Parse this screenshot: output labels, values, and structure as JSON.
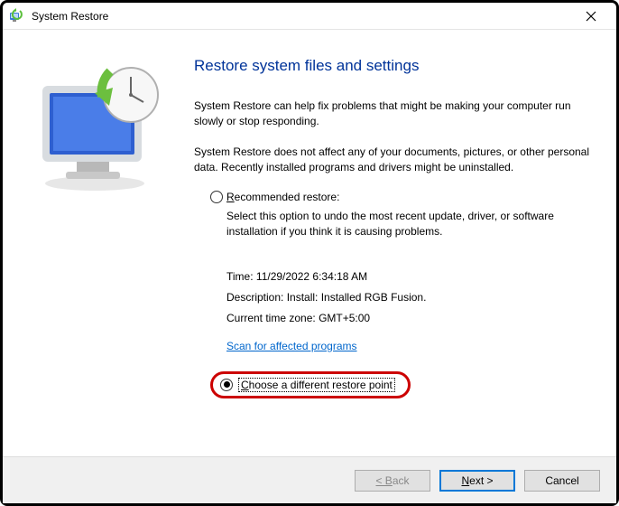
{
  "window": {
    "title": "System Restore"
  },
  "main": {
    "heading": "Restore system files and settings",
    "intro1": "System Restore can help fix problems that might be making your computer run slowly or stop responding.",
    "intro2": "System Restore does not affect any of your documents, pictures, or other personal data. Recently installed programs and drivers might be uninstalled."
  },
  "options": {
    "recommended": {
      "label": "Recommended restore:",
      "desc": "Select this option to undo the most recent update, driver, or software installation if you think it is causing problems.",
      "time_label": "Time:",
      "time_value": "11/29/2022 6:34:18 AM",
      "desc_label": "Description:",
      "desc_value": "Install: Installed RGB Fusion.",
      "tz_label": "Current time zone:",
      "tz_value": "GMT+5:00",
      "scan_link": "Scan for affected programs"
    },
    "different": {
      "label": "Choose a different restore point"
    },
    "selected": "different"
  },
  "footer": {
    "back": "< Back",
    "next": "Next >",
    "cancel": "Cancel"
  }
}
